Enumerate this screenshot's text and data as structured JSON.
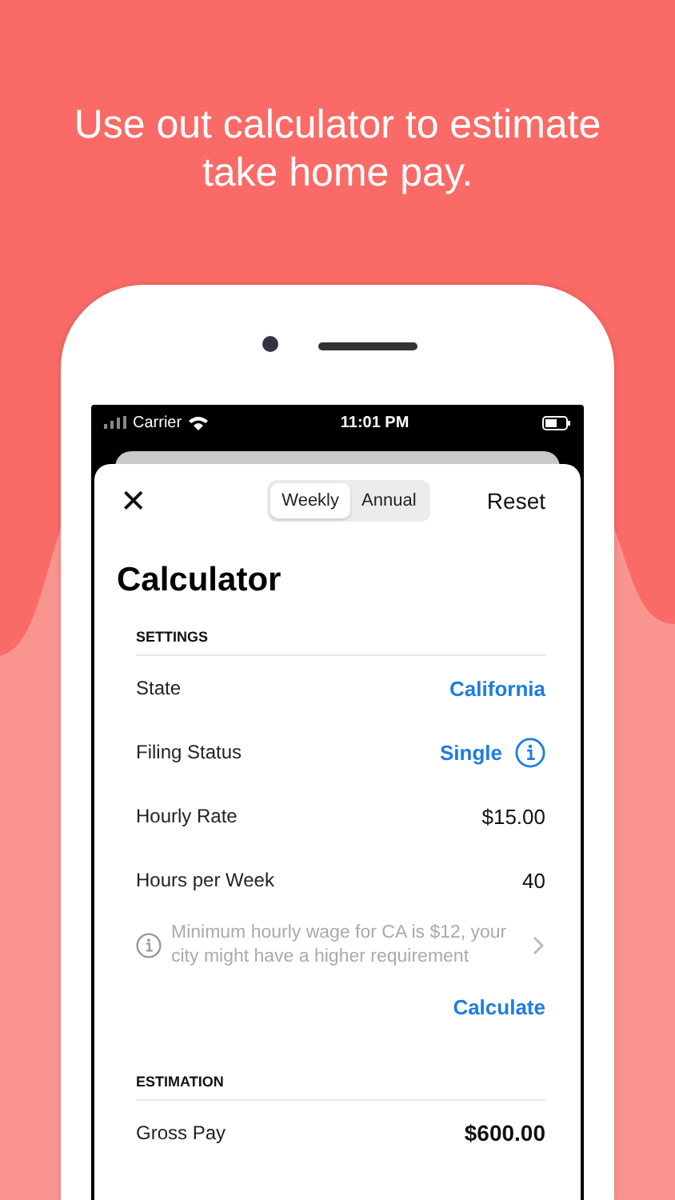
{
  "headline": "Use out calculator to estimate take home pay.",
  "status_bar": {
    "carrier": "Carrier",
    "time": "11:01 PM"
  },
  "header": {
    "close": "✕",
    "segments": [
      {
        "label": "Weekly",
        "selected": true
      },
      {
        "label": "Annual",
        "selected": false
      }
    ],
    "reset": "Reset"
  },
  "title": "Calculator",
  "settings": {
    "heading": "SETTINGS",
    "rows": [
      {
        "label": "State",
        "value": "California",
        "kind": "picker",
        "info": false
      },
      {
        "label": "Filing Status",
        "value": "Single",
        "kind": "picker",
        "info": true
      },
      {
        "label": "Hourly Rate",
        "value": "$15.00",
        "kind": "input",
        "info": false
      },
      {
        "label": "Hours per Week",
        "value": "40",
        "kind": "input",
        "info": false
      }
    ]
  },
  "note": "Minimum hourly wage for CA is $12, your city might have a higher requirement",
  "calculate": "Calculate",
  "estimation": {
    "heading": "ESTIMATION",
    "rows": [
      {
        "label": "Gross Pay",
        "value": "$600.00"
      }
    ]
  }
}
